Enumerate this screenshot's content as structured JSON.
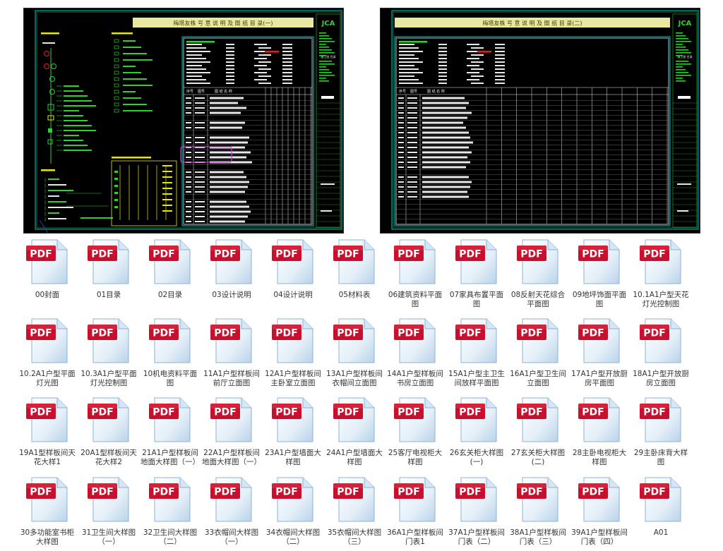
{
  "drawings": [
    {
      "title": "梅塔友株 号 意 说 明 及 图 纸 目 录(一)",
      "logo": "JCA",
      "block_left": "图 纸 目 录",
      "block_right": "施工图 目录",
      "table_header": [
        "序号",
        "图号",
        "图 纸 名 称"
      ]
    },
    {
      "title": "梅塔友株 号 意 说 明 及 图 纸 目 录(二)",
      "logo": "JCA",
      "block_left": "图 纸 目 录",
      "block_right": "施工图 目录",
      "table_header": [
        "序号",
        "图号",
        "图 纸 名 称"
      ]
    }
  ],
  "file_badge": "PDF",
  "files": [
    [
      "00封面",
      "01目录",
      "02目录",
      "03设计说明",
      "04设计说明",
      "05材料表",
      "06建筑资料平面图",
      "07家具布置平面图",
      "08反射天花综合平面图",
      "09地坪饰面平面图",
      "10.1A1户型天花灯光控制图"
    ],
    [
      "10.2A1户型平面灯光图",
      "10.3A1户型平面灯光控制图",
      "10机电资料平面图",
      "11A1户型样板间前厅立面图",
      "12A1户型样板间主卧室立面图",
      "13A1户型样板间衣帽间立面图",
      "14A1户型样板间书房立面图",
      "15A1户型主卫生间放样平面图",
      "16A1户型卫生间立面图",
      "17A1户型开放厨房平面图",
      "18A1户型开放厨房立面图"
    ],
    [
      "19A1型样板间天花大样1",
      "20A1型样板间天花大样2",
      "21A1户型样板间地面大样图（一）",
      "22A1户型样板间地面大样图（一）",
      "23A1户型墙面大样图",
      "24A1户型墙面大样图",
      "25客厅电视柜大样图",
      "26玄关柜大样图(一)",
      "27玄关柜大样图(二)",
      "28主卧电视柜大样图",
      "29主卧床背大样图"
    ],
    [
      "30多功能室书柜大样图",
      "31卫生间大样图（一）",
      "32卫生间大样图（二）",
      "33衣帽间大样图（一）",
      "34衣帽间大样图（二）",
      "35衣帽间大样图（三）",
      "36A1户型样板间门表1",
      "37A1户型样板间门表（二）",
      "38A1户型样板间门表（三）",
      "39A1户型样板间门表（四）",
      "A01"
    ]
  ],
  "colors": {
    "cad_background": "#000000",
    "cad_frame": "#00c8c8",
    "cad_title_bar": "#e8e8a0",
    "cad_text": "#e8e8e8",
    "cad_green": "#30d030",
    "cad_yellow": "#e8e800",
    "cad_red": "#e02020",
    "cad_magenta": "#d040d0",
    "pdf_badge": "#c8102e",
    "file_label": "#333333"
  },
  "icons": [
    "pdf-file-icon",
    "jca-logo"
  ]
}
